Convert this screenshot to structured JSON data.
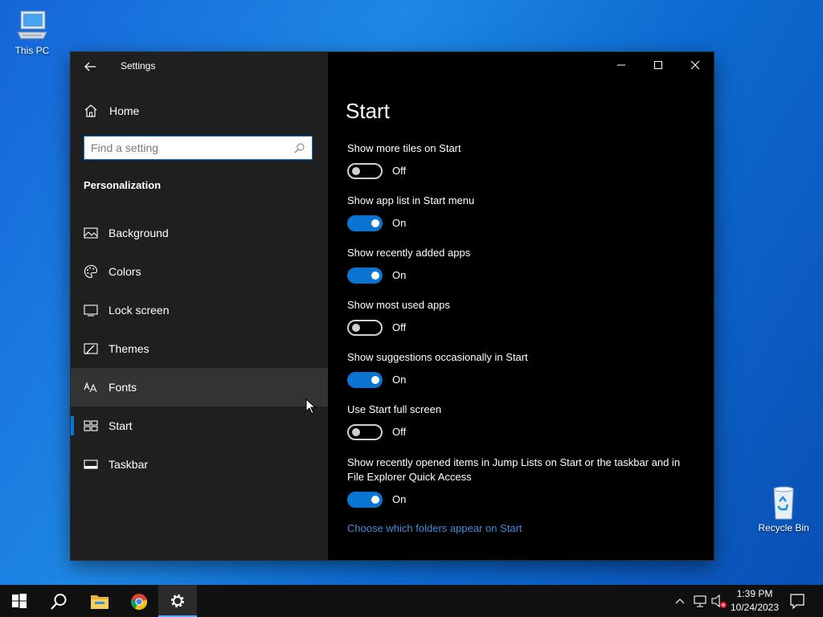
{
  "desktop": {
    "icons": [
      {
        "label": "This PC",
        "icon": "computer-icon"
      },
      {
        "label": "Recycle Bin",
        "icon": "recycle-bin-icon"
      }
    ]
  },
  "window": {
    "title": "Settings",
    "controls": {
      "minimize": "minimize-icon",
      "maximize": "maximize-icon",
      "close": "close-icon"
    }
  },
  "sidebar": {
    "home_label": "Home",
    "search_placeholder": "Find a setting",
    "section_title": "Personalization",
    "items": [
      {
        "label": "Background",
        "icon": "picture-icon"
      },
      {
        "label": "Colors",
        "icon": "palette-icon"
      },
      {
        "label": "Lock screen",
        "icon": "lock-screen-icon"
      },
      {
        "label": "Themes",
        "icon": "brush-icon"
      },
      {
        "label": "Fonts",
        "icon": "fonts-icon",
        "hovered": true
      },
      {
        "label": "Start",
        "icon": "start-icon",
        "selected": true
      },
      {
        "label": "Taskbar",
        "icon": "taskbar-icon"
      }
    ]
  },
  "main": {
    "page_title": "Start",
    "settings": [
      {
        "label": "Show more tiles on Start",
        "state": "Off"
      },
      {
        "label": "Show app list in Start menu",
        "state": "On"
      },
      {
        "label": "Show recently added apps",
        "state": "On"
      },
      {
        "label": "Show most used apps",
        "state": "Off"
      },
      {
        "label": "Show suggestions occasionally in Start",
        "state": "On"
      },
      {
        "label": "Use Start full screen",
        "state": "Off"
      },
      {
        "label": "Show recently opened items in Jump Lists on Start or the taskbar and in File Explorer Quick Access",
        "state": "On"
      }
    ],
    "link": "Choose which folders appear on Start"
  },
  "colors": {
    "accent": "#0078d7",
    "toggle_on": "#0a74d1",
    "link": "#3d8ee0"
  },
  "taskbar": {
    "buttons": [
      "start-button",
      "search-button",
      "file-explorer-button",
      "chrome-button",
      "settings-button"
    ],
    "clock": {
      "time": "1:39 PM",
      "date": "10/24/2023"
    }
  }
}
